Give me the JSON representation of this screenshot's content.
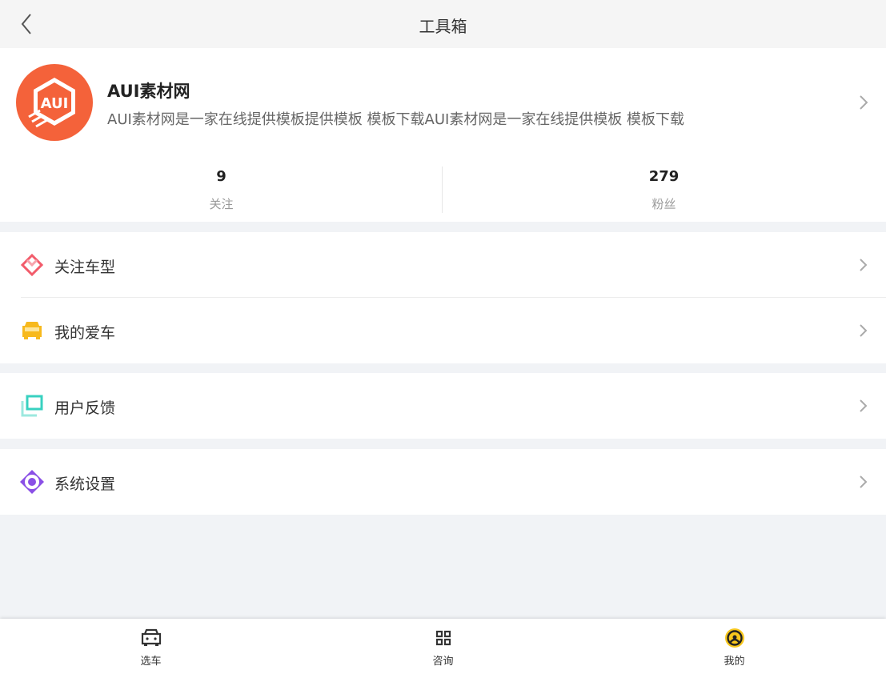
{
  "header": {
    "title": "工具箱",
    "back_icon": "chevron-left-icon"
  },
  "profile": {
    "avatar_text": "AUI",
    "avatar_color": "#f4623a",
    "name": "AUI素材网",
    "description": "AUI素材网是一家在线提供模板提供模板 模板下载AUI素材网是一家在线提供模板 模板下载",
    "stats": [
      {
        "value": "9",
        "label": "关注"
      },
      {
        "value": "279",
        "label": "粉丝"
      }
    ]
  },
  "menu": {
    "group1": [
      {
        "label": "关注车型",
        "icon": "heart-icon",
        "color": "#f25c6b"
      },
      {
        "label": "我的爱车",
        "icon": "car-icon",
        "color": "#f7b91d"
      }
    ],
    "group2": [
      {
        "label": "用户反馈",
        "icon": "feedback-icon",
        "color": "#38d1c0"
      }
    ],
    "group3": [
      {
        "label": "系统设置",
        "icon": "settings-icon",
        "color": "#8a4fe6"
      }
    ]
  },
  "tabbar": [
    {
      "label": "选车",
      "icon": "car-icon",
      "active": false
    },
    {
      "label": "咨询",
      "icon": "grid-icon",
      "active": false
    },
    {
      "label": "我的",
      "icon": "steering-wheel-icon",
      "active": true,
      "active_color": "#f7c71d"
    }
  ]
}
